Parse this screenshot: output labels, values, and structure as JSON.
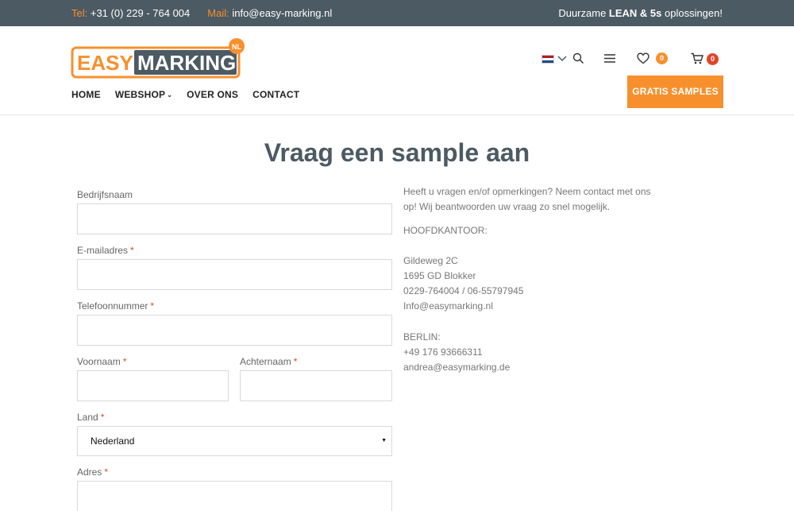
{
  "topbar": {
    "tel_label": "Tel:",
    "tel_value": "+31 (0) 229 - 764 004",
    "mail_label": "Mail:",
    "mail_value": "info@easy-marking.nl",
    "tagline_pre": "Duurzame ",
    "tagline_bold": "LEAN & 5s",
    "tagline_post": " oplossingen!"
  },
  "logo": {
    "part1": "EASY",
    "part2": "MARKING",
    "badge": "NL"
  },
  "nav": {
    "items": [
      "HOME",
      "WEBSHOP",
      "OVER ONS",
      "CONTACT"
    ],
    "caret": "⌄"
  },
  "tools": {
    "wishlist_count": "0",
    "cart_count": "0"
  },
  "cta_label": "GRATIS SAMPLES",
  "page_title": "Vraag een sample aan",
  "form": {
    "company_label": "Bedrijfsnaam",
    "email_label": "E-mailadres",
    "phone_label": "Telefoonnummer",
    "firstname_label": "Voornaam",
    "lastname_label": "Achternaam",
    "country_label": "Land",
    "country_value": "Nederland",
    "address_label": "Adres",
    "required_mark": "*",
    "select_arrow": "▼"
  },
  "info": {
    "intro": "Heeft u vragen en/of opmerkingen? Neem contact met ons op! Wij beantwoorden uw vraag zo snel mogelijk.",
    "hq_heading": "HOOFDKANTOOR:",
    "hq_street": "Gildeweg 2C",
    "hq_city": "1695 GD Blokker",
    "hq_phone": "0229-764004 / 06-55797945",
    "hq_email": "Info@easymarking.nl",
    "berlin_heading": "BERLIN:",
    "berlin_phone": "+49 176 93666311",
    "berlin_email": "andrea@easymarking.de"
  },
  "colors": {
    "accent": "#f7902c",
    "dark": "#4c5a63",
    "badge_red": "#e0452b"
  }
}
